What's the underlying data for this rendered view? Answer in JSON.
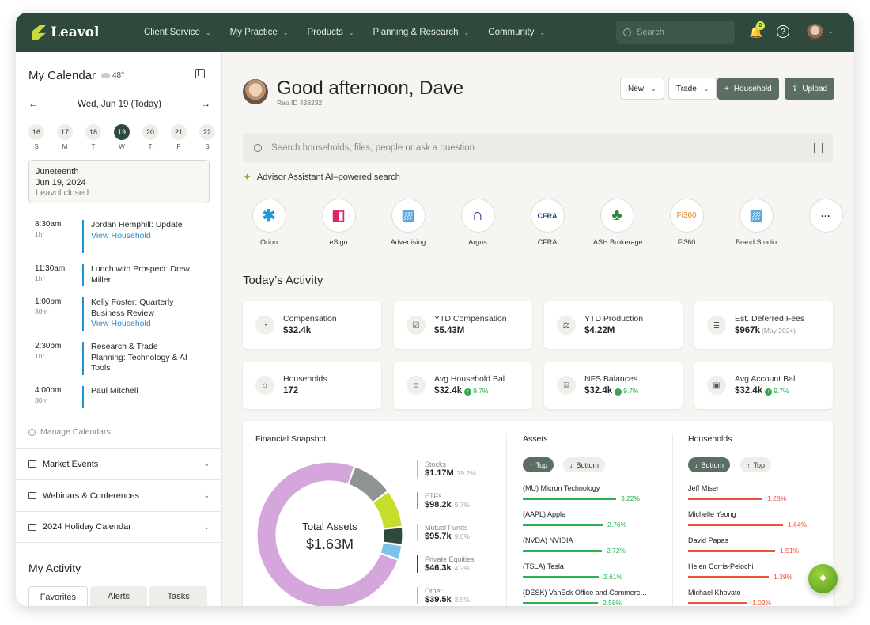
{
  "brand": {
    "name": "Leavol",
    "accent": "#c7dd35",
    "nav_bg": "#2f4a3c"
  },
  "nav": {
    "items": [
      "Client Service",
      "My Practice",
      "Products",
      "Planning & Research",
      "Community"
    ],
    "search_placeholder": "Search",
    "notification_count": "2"
  },
  "calendar": {
    "title": "My Calendar",
    "weather": "48°",
    "current_date": "Wed, Jun 19 (Today)",
    "days": [
      {
        "num": "16",
        "wd": "S"
      },
      {
        "num": "17",
        "wd": "M"
      },
      {
        "num": "18",
        "wd": "T"
      },
      {
        "num": "19",
        "wd": "W"
      },
      {
        "num": "20",
        "wd": "T"
      },
      {
        "num": "21",
        "wd": "F"
      },
      {
        "num": "22",
        "wd": "S"
      }
    ],
    "holiday": {
      "name": "Juneteenth",
      "date": "Jun 19, 2024",
      "note": "Leavol closed"
    },
    "events": [
      {
        "time": "8:30am",
        "dur": "1hr",
        "title": "Jordan Hemphill: Update",
        "link": "View Household"
      },
      {
        "time": "11:30am",
        "dur": "1hr",
        "title": "Lunch with Prospect: Drew Miller",
        "link": ""
      },
      {
        "time": "1:00pm",
        "dur": "30m",
        "title": "Kelly Foster: Quarterly Business Review",
        "link": "View Household"
      },
      {
        "time": "2:30pm",
        "dur": "1hr",
        "title": "Research & Trade Planning: Technology & AI Tools",
        "link": ""
      },
      {
        "time": "4:00pm",
        "dur": "30m",
        "title": "Paul Mitchell",
        "link": ""
      }
    ],
    "manage": "Manage Calendars"
  },
  "accordions": [
    "Market Events",
    "Webinars & Conferences",
    "2024 Holiday Calendar"
  ],
  "activity": {
    "title": "My Activity",
    "tabs": [
      "Favorites",
      "Alerts",
      "Tasks"
    ]
  },
  "header": {
    "greeting": "Good afternoon, Dave",
    "rep_id": "Rep ID 438232",
    "new": "New",
    "trade": "Trade",
    "household": "Household",
    "upload": "Upload"
  },
  "search": {
    "placeholder": "Search households, files, people or ask a question",
    "assistant": "Advisor Assistant AI–powered search"
  },
  "apps": [
    {
      "label": "Orion",
      "glyph": "✱",
      "color": "#1a9be0"
    },
    {
      "label": "eSign",
      "glyph": "◧",
      "color": "#e0245e"
    },
    {
      "label": "Advertising",
      "glyph": "▨",
      "color": "#4aa3df"
    },
    {
      "label": "Argus",
      "glyph": "∩",
      "color": "#1e3a8a"
    },
    {
      "label": "CFRA",
      "glyph": "CFRA",
      "color": "#1e3a8a"
    },
    {
      "label": "ASH Brokerage",
      "glyph": "♣",
      "color": "#2e8b3e"
    },
    {
      "label": "Fi360",
      "glyph": "Fi360",
      "color": "#e08a2e"
    },
    {
      "label": "Brand Studio",
      "glyph": "▨",
      "color": "#4aa3df"
    },
    {
      "label": "",
      "glyph": "···",
      "color": "#333"
    }
  ],
  "today": {
    "title": "Today’s Activity",
    "cards": [
      {
        "label": "Compensation",
        "value": "$32.4k",
        "icon": "piggy-bank-icon",
        "glyph": "◔"
      },
      {
        "label": "YTD Compensation",
        "value": "$5.43M",
        "icon": "calendar-check-icon",
        "glyph": "☑"
      },
      {
        "label": "YTD Production",
        "value": "$4.22M",
        "icon": "scale-icon",
        "glyph": "⚖"
      },
      {
        "label": "Est. Deferred Fees",
        "value": "$967k",
        "note": "(May 2024)",
        "icon": "coins-icon",
        "glyph": "≣"
      },
      {
        "label": "Households",
        "value": "172",
        "icon": "house-icon",
        "glyph": "⌂"
      },
      {
        "label": "Avg Household Bal",
        "value": "$32.4k",
        "pct": "9.7%",
        "icon": "people-icon",
        "glyph": "☺"
      },
      {
        "label": "NFS Balances",
        "value": "$32.4k",
        "pct": "9.7%",
        "icon": "bank-icon",
        "glyph": "⌸"
      },
      {
        "label": "Avg Account Bal",
        "value": "$32.4k",
        "pct": "9.7%",
        "icon": "wallet-icon",
        "glyph": "▣"
      }
    ]
  },
  "snapshot": {
    "title": "Financial Snapshot",
    "total_label": "Total Assets",
    "total_value": "$1.63M",
    "legend": [
      {
        "name": "Stocks",
        "value": "$1.17M",
        "pct": "79.2%",
        "color": "#d5a6dc"
      },
      {
        "name": "ETFs",
        "value": "$98.2k",
        "pct": "9.7%",
        "color": "#8e9590"
      },
      {
        "name": "Mutual Funds",
        "value": "$95.7k",
        "pct": "9.0%",
        "color": "#c6dd2c"
      },
      {
        "name": "Private Equities",
        "value": "$46.3k",
        "pct": "4.2%",
        "color": "#2f4a3c"
      },
      {
        "name": "Other",
        "value": "$39.5k",
        "pct": "3.5%",
        "color": "#7cc3ea"
      }
    ]
  },
  "chart_data": {
    "type": "pie",
    "title": "Financial Snapshot",
    "categories": [
      "Stocks",
      "ETFs",
      "Mutual Funds",
      "Private Equities",
      "Other"
    ],
    "values": [
      79.2,
      9.7,
      9.0,
      4.2,
      3.5
    ],
    "center_label": "Total Assets",
    "center_value": "$1.63M"
  },
  "assets": {
    "title": "Assets",
    "toggle_on": "Top",
    "toggle_off": "Bottom",
    "rows": [
      {
        "name": "(MU) Micron Technology",
        "pct": "3.22%",
        "v": 3.22
      },
      {
        "name": "(AAPL) Apple",
        "pct": "2.76%",
        "v": 2.76
      },
      {
        "name": "(NVDA) NVIDIA",
        "pct": "2.72%",
        "v": 2.72
      },
      {
        "name": "(TSLA) Tesla",
        "pct": "2.61%",
        "v": 2.61
      },
      {
        "name": "(DESK) VanEck Office and Commerc…",
        "pct": "2.58%",
        "v": 2.58
      }
    ]
  },
  "households": {
    "title": "Households",
    "toggle_on": "Bottom",
    "toggle_off": "Top",
    "rows": [
      {
        "name": "Jeff Miser",
        "pct": "1.28%",
        "v": 1.28
      },
      {
        "name": "Michelle Yeong",
        "pct": "1.64%",
        "v": 1.64
      },
      {
        "name": "David Papas",
        "pct": "1.51%",
        "v": 1.51
      },
      {
        "name": "Helen Corris-Pelochi",
        "pct": "1.39%",
        "v": 1.39
      },
      {
        "name": "Michael Khovato",
        "pct": "1.02%",
        "v": 1.02
      }
    ]
  }
}
